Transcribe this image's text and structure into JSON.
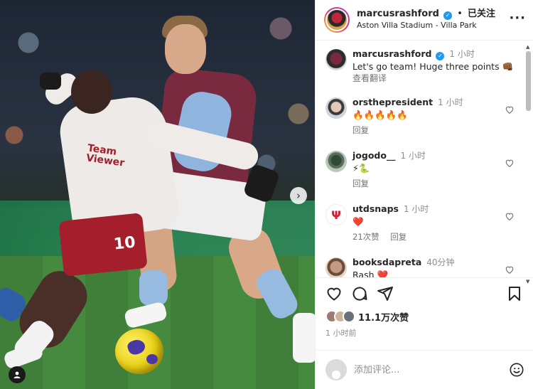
{
  "post": {
    "username": "marcusrashford",
    "follow_status": "已关注",
    "location": "Aston Villa Stadium - Villa Park",
    "caption": {
      "username": "marcusrashford",
      "time": "1 小时",
      "text": "Let's go team! Huge three points",
      "emoji": "👊🏾",
      "translate_label": "查看翻译"
    },
    "comments": [
      {
        "username": "orsthepresident",
        "time": "1 小时",
        "text": "🔥🔥🔥🔥🔥",
        "reply_label": "回复"
      },
      {
        "username": "jogodo__",
        "time": "1 小时",
        "text": "⚡🐍",
        "reply_label": "回复"
      },
      {
        "username": "utdsnaps",
        "time": "1 小时",
        "text": "❤️",
        "likes_label": "21次赞",
        "reply_label": "回复"
      },
      {
        "username": "booksdapreta",
        "time": "40分钟",
        "text": "Rash ❤️",
        "reply_label": ""
      }
    ],
    "likes_count": "11.1万次赞",
    "posted_time": "1 小时前",
    "add_comment_placeholder": "添加评论...",
    "sponsor_text": "Team\nViewer",
    "shirt_number": "10"
  },
  "colors": {
    "verified": "#1d9bf0",
    "like_red": "#ed4956",
    "muted": "#8e8e8e"
  },
  "icons": {
    "media_next": "chevron-right-icon",
    "tag": "user-tag-icon",
    "more": "ellipsis-icon",
    "like": "heart-icon",
    "comment": "comment-bubble-icon",
    "share": "paper-plane-icon",
    "save": "bookmark-icon",
    "emoji": "smiley-icon"
  }
}
